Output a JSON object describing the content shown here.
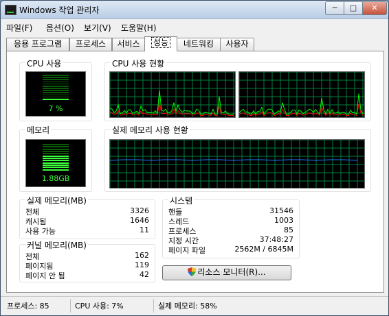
{
  "window": {
    "title": "Windows 작업 관리자",
    "min_label": "─",
    "max_label": "□",
    "close_label": "✕",
    "icon": "task-manager-icon"
  },
  "menu": [
    "파일(F)",
    "옵션(O)",
    "보기(V)",
    "도움말(H)"
  ],
  "tabs": [
    "응용 프로그램",
    "프로세스",
    "서비스",
    "성능",
    "네트워킹",
    "사용자"
  ],
  "active_tab": "성능",
  "cpu_usage": {
    "label": "CPU 사용",
    "value": "7 %",
    "percent": 7
  },
  "cpu_history": {
    "label": "CPU 사용 현황"
  },
  "memory": {
    "label": "메모리",
    "value": "1.88GB",
    "percent": 58
  },
  "memory_history": {
    "label": "실제 메모리 사용 현황"
  },
  "physical_memory": {
    "label": "실제 메모리(MB)",
    "rows": [
      {
        "name": "전체",
        "value": "3326"
      },
      {
        "name": "캐시됨",
        "value": "1646"
      },
      {
        "name": "사용 가능",
        "value": "11"
      }
    ]
  },
  "kernel_memory": {
    "label": "커널 메모리(MB)",
    "rows": [
      {
        "name": "전체",
        "value": "162"
      },
      {
        "name": "페이지됨",
        "value": "119"
      },
      {
        "name": "페이지 안 됨",
        "value": "42"
      }
    ]
  },
  "system": {
    "label": "시스템",
    "rows": [
      {
        "name": "핸들",
        "value": "31546"
      },
      {
        "name": "스레드",
        "value": "1003"
      },
      {
        "name": "프로세스",
        "value": "85"
      },
      {
        "name": "지정 시간",
        "value": "37:48:27"
      },
      {
        "name": "페이지 파일",
        "value": "2562M / 6845M"
      }
    ]
  },
  "resource_monitor_button": {
    "label": "리소스 모니터(R)...",
    "icon": "shield-icon"
  },
  "status": {
    "processes": "프로세스: 85",
    "cpu": "CPU 사용: 7%",
    "memory": "실제 메모리: 58%"
  },
  "colors": {
    "graph_grid": "#008040",
    "graph_line": "#00ff00",
    "kernel_line": "#ff0000",
    "memory_line": "#2a78ff",
    "meter_on": "#3cff3c",
    "meter_off": "#0a5a0a"
  }
}
